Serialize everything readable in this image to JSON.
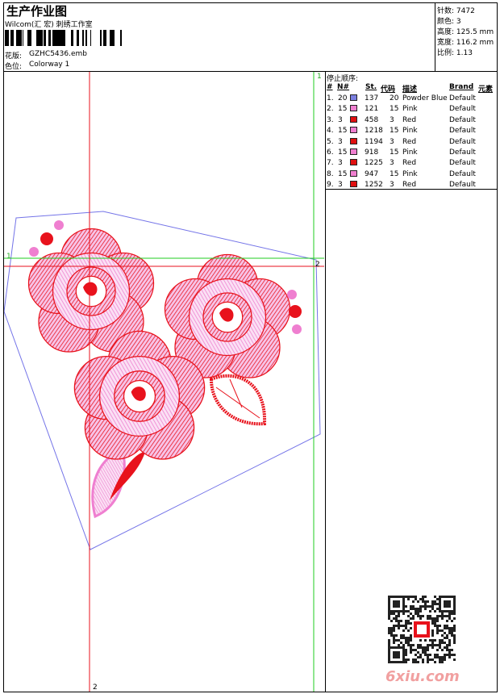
{
  "header": {
    "title": "生产作业图",
    "company": "Wilcom(汇 宏) 刺绣工作室",
    "pattern_label": "花版:",
    "pattern_value": "GZHC5436.emb",
    "colorway_label": "色位:",
    "colorway_value": "Colorway 1"
  },
  "specs": [
    {
      "label": "针数:",
      "value": "7472"
    },
    {
      "label": "颜色:",
      "value": "3"
    },
    {
      "label": "高度:",
      "value": "125.5 mm"
    },
    {
      "label": "宽度:",
      "value": "116.2 mm"
    },
    {
      "label": "比例:",
      "value": "1.13"
    }
  ],
  "stop_sequence": {
    "title": "停止顺序:",
    "columns": [
      "#",
      "N#",
      "St.",
      "代码",
      "描述",
      "Brand",
      "元素"
    ],
    "rows": [
      {
        "idx": "1.",
        "n": "20",
        "color": "#7b7fe0",
        "st": "137",
        "code": "20",
        "desc": "Powder Blue",
        "brand": "Default"
      },
      {
        "idx": "2.",
        "n": "15",
        "color": "#ef7fd0",
        "st": "121",
        "code": "15",
        "desc": "Pink",
        "brand": "Default"
      },
      {
        "idx": "3.",
        "n": "3",
        "color": "#e01010",
        "st": "458",
        "code": "3",
        "desc": "Red",
        "brand": "Default"
      },
      {
        "idx": "4.",
        "n": "15",
        "color": "#ef7fd0",
        "st": "1218",
        "code": "15",
        "desc": "Pink",
        "brand": "Default"
      },
      {
        "idx": "5.",
        "n": "3",
        "color": "#e01010",
        "st": "1194",
        "code": "3",
        "desc": "Red",
        "brand": "Default"
      },
      {
        "idx": "6.",
        "n": "15",
        "color": "#ef7fd0",
        "st": "918",
        "code": "15",
        "desc": "Pink",
        "brand": "Default"
      },
      {
        "idx": "7.",
        "n": "3",
        "color": "#e01010",
        "st": "1225",
        "code": "3",
        "desc": "Red",
        "brand": "Default"
      },
      {
        "idx": "8.",
        "n": "15",
        "color": "#ef7fd0",
        "st": "947",
        "code": "15",
        "desc": "Pink",
        "brand": "Default"
      },
      {
        "idx": "9.",
        "n": "3",
        "color": "#e01010",
        "st": "1252",
        "code": "3",
        "desc": "Red",
        "brand": "Default"
      }
    ]
  },
  "guides": {
    "green_v": "1",
    "green_h": "1",
    "red_h": "2",
    "red_v": "2"
  },
  "watermark": "6xiu.com",
  "colors": {
    "red": "#e8121c",
    "pink": "#f08bd2",
    "blue": "#7474e8",
    "green": "#22cc22"
  }
}
